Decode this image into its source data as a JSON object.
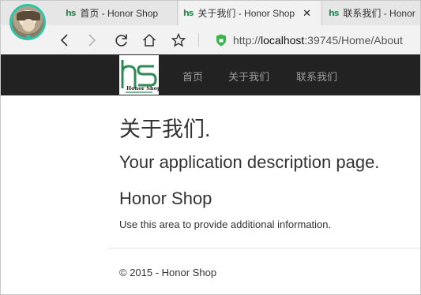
{
  "browser": {
    "tabs": [
      {
        "label": "首页 - Honor Shop",
        "active": false
      },
      {
        "label": "关于我们 - Honor Shop",
        "active": true
      },
      {
        "label": "联系我们 - Honor",
        "active": false
      }
    ],
    "favicon_text": "hs",
    "close_glyph": "✕",
    "address": {
      "scheme": "http://",
      "host": "localhost",
      "rest": ":39745/Home/About"
    },
    "icons": [
      "back-icon",
      "forward-icon",
      "refresh-icon",
      "home-icon",
      "star-icon",
      "lock-icon"
    ]
  },
  "site": {
    "logo_text": "Honor Shop",
    "nav": [
      {
        "label": "首页"
      },
      {
        "label": "关于我们"
      },
      {
        "label": "联系我们"
      }
    ],
    "colors": {
      "navbar": "#222222",
      "nav_link": "#9d9d9d",
      "logo_green": "#2e8b57"
    }
  },
  "main": {
    "title": "关于我们.",
    "subtitle": "Your application description page.",
    "heading": "Honor Shop",
    "paragraph": "Use this area to provide additional information.",
    "footer": "© 2015 - Honor Shop"
  }
}
